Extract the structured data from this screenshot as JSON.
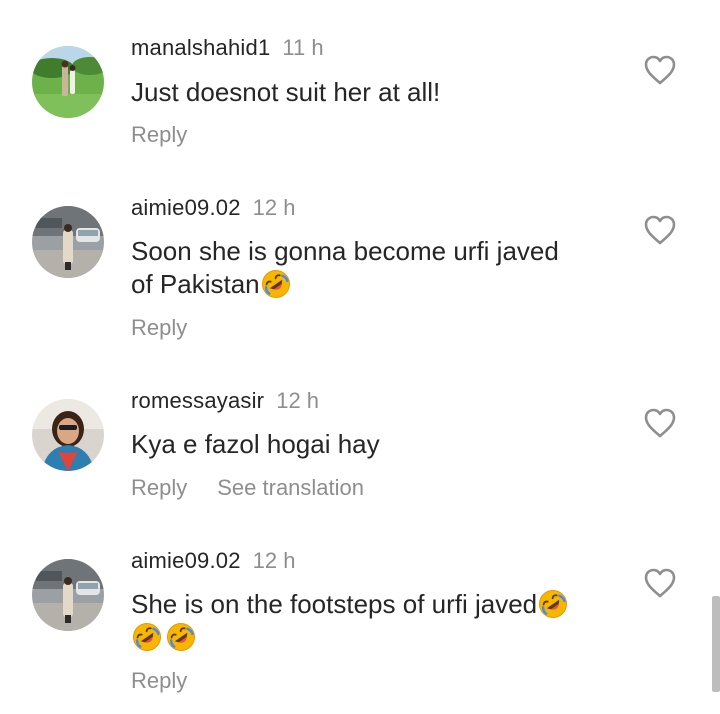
{
  "comments": [
    {
      "username": "manalshahid1",
      "time": "11 h",
      "text": "Just doesnot suit her at all!",
      "reply_label": "Reply"
    },
    {
      "username": "aimie09.02",
      "time": "12 h",
      "text_line1": "Soon she is gonna become  urfi javed",
      "text_line2": "of Pakistan",
      "reply_label": "Reply"
    },
    {
      "username": "romessayasir",
      "time": "12 h",
      "text": "Kya e fazol hogai hay",
      "reply_label": "Reply",
      "translation_label": "See translation"
    },
    {
      "username": "aimie09.02",
      "time": "12 h",
      "text": "She is on the footsteps of urfi javed",
      "reply_label": "Reply"
    }
  ],
  "icons": {
    "like": "heart-outline-icon",
    "emoji": "rolling-on-floor-laughing-emoji"
  },
  "colors": {
    "text": "#262626",
    "secondary": "#8e8e8e",
    "emoji_yellow": "#f7b600",
    "emoji_tears": "#3d8bff"
  }
}
